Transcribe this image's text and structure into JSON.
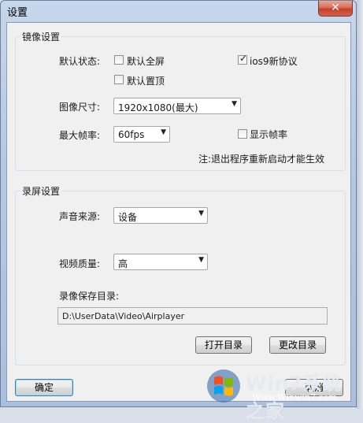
{
  "window": {
    "title": "设置",
    "close_label": "✕"
  },
  "mirror": {
    "legend": "镜像设置",
    "default_state_label": "默认状态:",
    "fullscreen": {
      "label": "默认全屏",
      "checked": false
    },
    "ios9": {
      "label": "ios9新协议",
      "checked": true
    },
    "topmost": {
      "label": "默认置顶",
      "checked": false
    },
    "image_size_label": "图像尺寸:",
    "image_size_value": "1920x1080(最大)",
    "max_fps_label": "最大帧率:",
    "max_fps_value": "60fps",
    "show_fps": {
      "label": "显示帧率",
      "checked": false
    },
    "note": "注:退出程序重新启动才能生效"
  },
  "record": {
    "legend": "录屏设置",
    "audio_source_label": "声音来源:",
    "audio_source_value": "设备",
    "video_quality_label": "视频质量:",
    "video_quality_value": "高",
    "save_dir_label": "录像保存目录:",
    "save_dir_value": "D:\\UserData\\Video\\Airplayer",
    "open_dir_button": "打开目录",
    "change_dir_button": "更改目录"
  },
  "footer": {
    "ok_button": "确定",
    "cancel_button": "取消"
  },
  "watermark": {
    "name": "Win7系统之家",
    "url": "Www.Winwin7.com"
  },
  "icons": {
    "checkmark": "✓",
    "dropdown": "▼"
  }
}
